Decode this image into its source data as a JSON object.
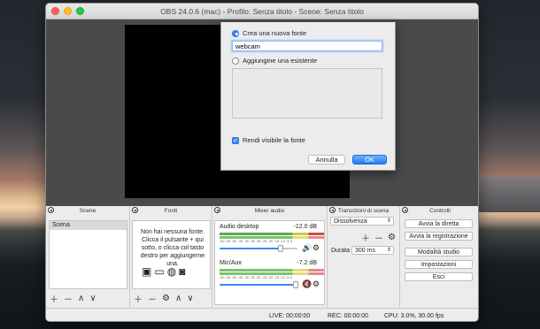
{
  "window": {
    "title": "OBS 24.0.6 (mac) - Profilo: Senza titolo - Scene: Senza titolo"
  },
  "dialog": {
    "create_new_label": "Crea una nuova fonte",
    "source_name_value": "webcam",
    "add_existing_label": "Aggiungine una esistente",
    "visible_label": "Rendi visibile la fonte",
    "cancel_label": "Annulla",
    "ok_label": "OK"
  },
  "docks": {
    "scenes": {
      "title": "Scene",
      "items": [
        "Scena"
      ]
    },
    "sources": {
      "title": "Fonti",
      "empty_text": "Non hai nessuna fonte. Clicca il pulsante + qui sotto, o clicca col tasto destro per aggiungerne una."
    },
    "mixer": {
      "title": "Mixer audio",
      "tick_labels": "-60 -55 -50 -45 -40 -35 -30 -25 -20 -15 -10 -5 0",
      "channels": [
        {
          "name": "Audio desktop",
          "db": "-12.0 dB",
          "volume": 0.78,
          "muted": false
        },
        {
          "name": "Mic/Aux",
          "db": "-7.2 dB",
          "volume": 0.98,
          "muted": true
        }
      ]
    },
    "transitions": {
      "title": "Transizioni di scena",
      "selected": "Dissolvenza",
      "duration_label": "Durata",
      "duration_value": "300 ms"
    },
    "controls": {
      "title": "Controlli",
      "buttons": [
        "Avvia la diretta",
        "Avvia la registrazione",
        "Modalità studio",
        "Impostazioni",
        "Esci"
      ]
    }
  },
  "status": {
    "live": "LIVE: 00:00:00",
    "rec": "REC: 00:00:00",
    "cpu": "CPU: 3.0%, 30.00 fps"
  },
  "colors": {
    "accent": "#3b8df3",
    "meter_green": "#5bab48",
    "meter_yellow": "#d8c83c",
    "meter_red": "#d04b48",
    "mute_red": "#d9302c"
  }
}
